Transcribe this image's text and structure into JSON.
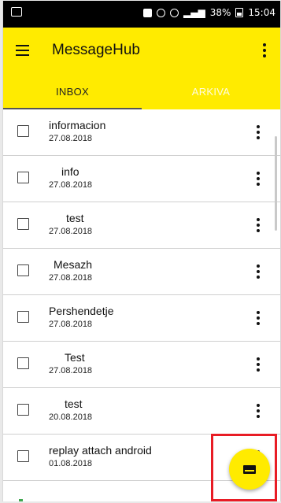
{
  "status_bar": {
    "battery": "38%",
    "time": "15:04"
  },
  "app_bar": {
    "title": "MessageHub"
  },
  "tabs": [
    {
      "label": "INBOX"
    },
    {
      "label": "ARKIVA"
    }
  ],
  "messages": [
    {
      "subject": "informacion",
      "date": "27.08.2018"
    },
    {
      "subject": "info",
      "date": "27.08.2018"
    },
    {
      "subject": "test",
      "date": "27.08.2018"
    },
    {
      "subject": "Mesazh",
      "date": "27.08.2018"
    },
    {
      "subject": "Pershendetje",
      "date": "27.08.2018"
    },
    {
      "subject": "Test",
      "date": "27.08.2018"
    },
    {
      "subject": "test",
      "date": "20.08.2018"
    },
    {
      "subject": "replay attach android",
      "date": "01.08.2018"
    }
  ],
  "colors": {
    "accent": "#ffeb00",
    "highlight": "#e81c25"
  }
}
